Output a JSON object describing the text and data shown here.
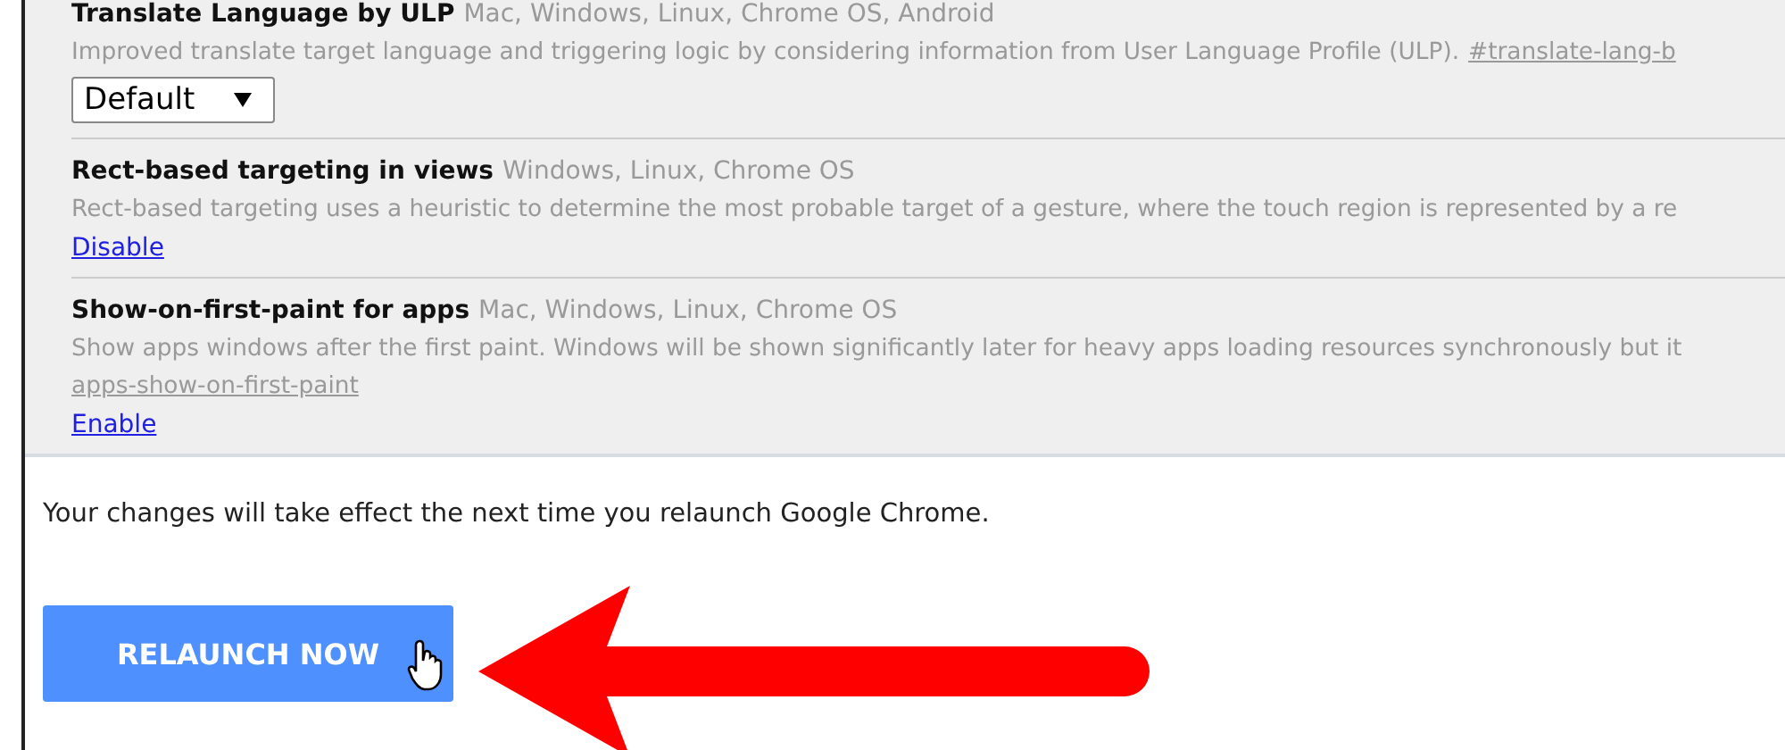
{
  "flags": [
    {
      "name": "Translate Language by ULP",
      "platforms": "Mac, Windows, Linux, Chrome OS, Android",
      "description": "Improved translate target language and triggering logic by considering information from User Language Profile (ULP).",
      "tag": "#translate-lang-b",
      "control": {
        "kind": "select",
        "value": "Default"
      }
    },
    {
      "name": "Rect-based targeting in views",
      "platforms": "Windows, Linux, Chrome OS",
      "description": "Rect-based targeting uses a heuristic to determine the most probable target of a gesture, where the touch region is represented by a re",
      "control": {
        "kind": "link",
        "label": "Disable"
      }
    },
    {
      "name": "Show-on-first-paint for apps",
      "platforms": "Mac, Windows, Linux, Chrome OS",
      "description": "Show apps windows after the first paint. Windows will be shown significantly later for heavy apps loading resources synchronously but it",
      "tag_line": "apps-show-on-first-paint",
      "control": {
        "kind": "link",
        "label": "Enable"
      }
    }
  ],
  "notice": {
    "message": "Your changes will take effect the next time you relaunch Google Chrome.",
    "button": "RELAUNCH NOW"
  }
}
